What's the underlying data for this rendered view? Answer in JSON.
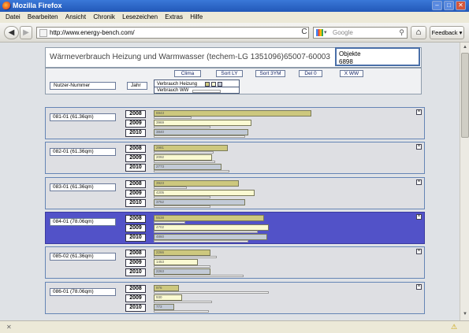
{
  "window": {
    "title": "Mozilla Firefox",
    "minimize": "–",
    "maximize": "□",
    "close": "✕"
  },
  "menu": [
    "Datei",
    "Bearbeiten",
    "Ansicht",
    "Chronik",
    "Lesezeichen",
    "Extras",
    "Hilfe"
  ],
  "nav": {
    "back": "◀",
    "forward": "▶",
    "url": "http://www.energy-bench.com/",
    "reload": "C",
    "search_placeholder": "Google",
    "search_arrow": "▾",
    "search_glyph": "⚲",
    "home": "⌂",
    "feedback": "Feedback ▾"
  },
  "page": {
    "title": "Wärmeverbrauch Heizung und Warmwasser (techem-LG 1351096)65007-60003",
    "objects_label": "Objekte",
    "objects_value": "6898",
    "buttons": [
      "Clima",
      "Sort LY",
      "Sort 3YM",
      "Del 0",
      "X WW"
    ],
    "nutzer_label": "Nutzer-Nummer",
    "jahr_label": "Jahr",
    "legend_heizung": "Verbrauch Heizung",
    "legend_ww": "Verbrauch WW",
    "years": [
      "2008",
      "2009",
      "2010"
    ],
    "close_glyph": "×",
    "colors": {
      "y2008": "#cdc87e",
      "y2009": "#fafad2",
      "y2010": "#c2cad6",
      "selected": "#5252c8"
    }
  },
  "units": [
    {
      "name": "081-01 (61.36qm)",
      "selected": false,
      "values": [
        "6943",
        "3969",
        "3840"
      ],
      "fill": [
        1.0,
        0.62,
        0.6
      ],
      "ref": [
        0.24,
        0.36,
        0.58
      ]
    },
    {
      "name": "082-01 (61.36qm)",
      "selected": false,
      "values": [
        "2981",
        "2092",
        "2773"
      ],
      "fill": [
        0.47,
        0.37,
        0.43
      ],
      "ref": [
        0.38,
        0.39,
        0.48
      ]
    },
    {
      "name": "083-01 (61.36qm)",
      "selected": false,
      "values": [
        "3923",
        "4205",
        "3752"
      ],
      "fill": [
        0.54,
        0.64,
        0.58
      ],
      "ref": [
        0.21,
        0.36,
        0.36
      ]
    },
    {
      "name": "084-01 (78.06qm)",
      "selected": true,
      "values": [
        "5538",
        "4702",
        "4860"
      ],
      "fill": [
        0.7,
        0.73,
        0.72
      ],
      "ref": [
        0.2,
        0.66,
        0.6
      ]
    },
    {
      "name": "085-02 (61.36qm)",
      "selected": false,
      "values": [
        "2266",
        "1453",
        "2263"
      ],
      "fill": [
        0.36,
        0.28,
        0.36
      ],
      "ref": [
        0.4,
        0.36,
        0.57
      ]
    },
    {
      "name": "086-01 (78.06qm)",
      "selected": false,
      "values": [
        "976",
        "930",
        "773"
      ],
      "fill": [
        0.16,
        0.18,
        0.13
      ],
      "ref": [
        0.73,
        0.37,
        0.35
      ]
    }
  ],
  "status": {
    "left": "✕",
    "right": "⚠"
  }
}
